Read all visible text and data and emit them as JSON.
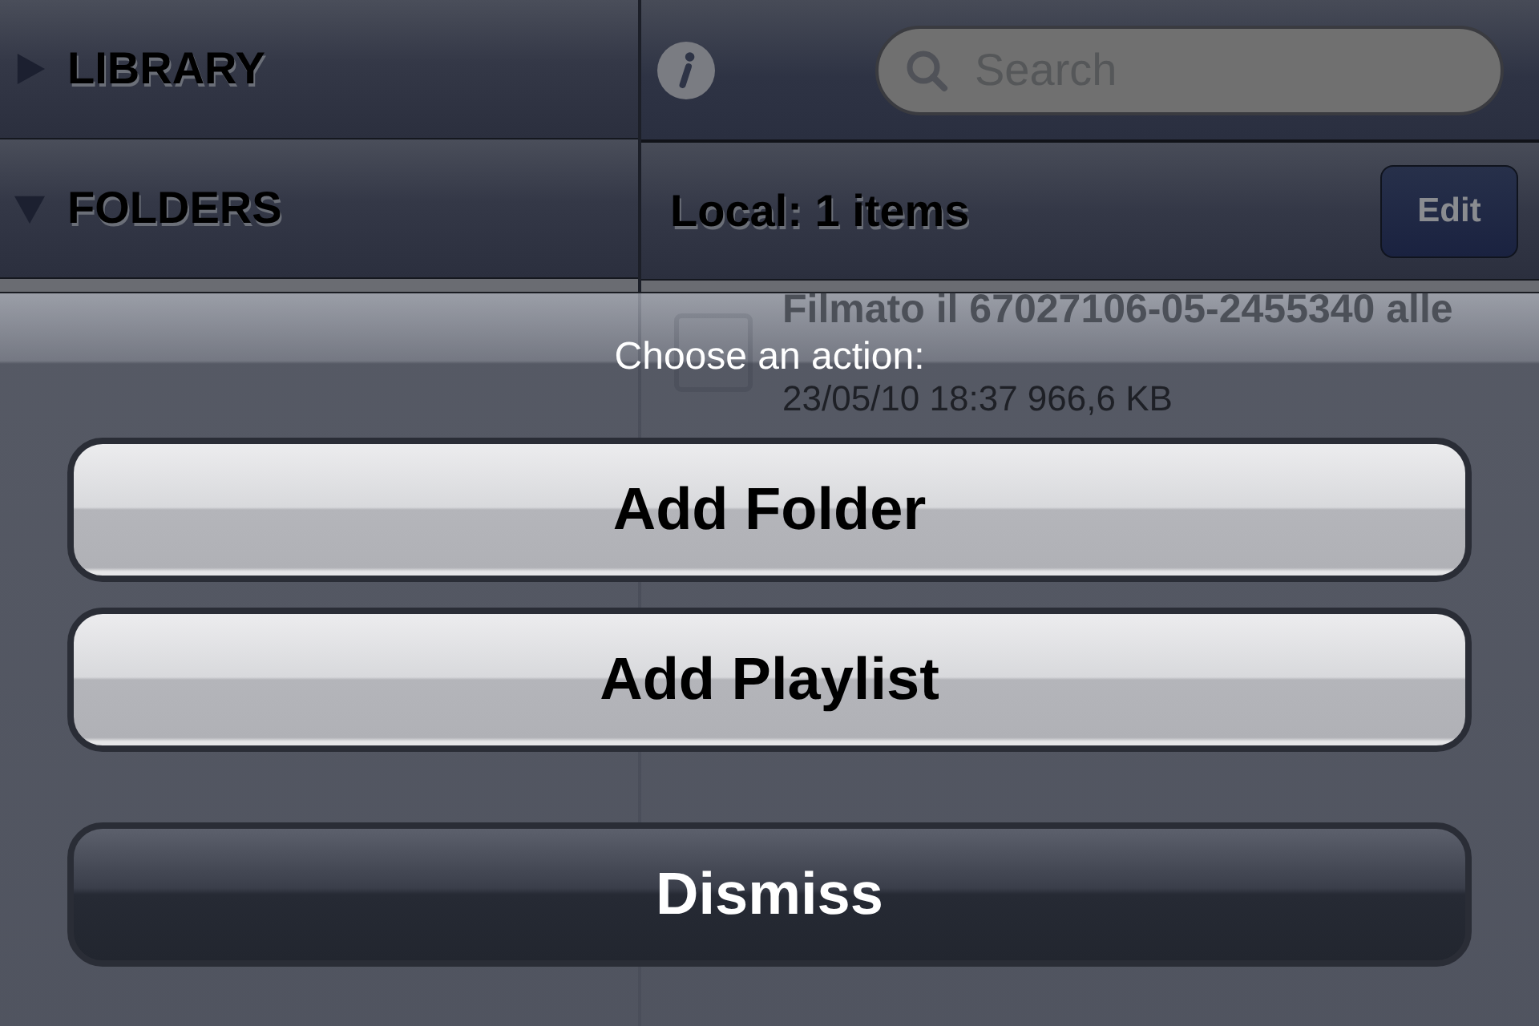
{
  "sidebar": {
    "sections": [
      {
        "label": "LIBRARY",
        "expanded": false
      },
      {
        "label": "FOLDERS",
        "expanded": true
      }
    ]
  },
  "toolbar": {
    "search": {
      "placeholder": "Search"
    }
  },
  "list_header": {
    "title": "Local: 1 items",
    "edit_button": "Edit"
  },
  "items": [
    {
      "title": "Filmato il 67027106-05-2455340 alle",
      "details": "23/05/10 18:37 966,6 KB"
    }
  ],
  "action_sheet": {
    "title": "Choose an action:",
    "buttons": [
      {
        "label": "Add Folder",
        "kind": "default"
      },
      {
        "label": "Add Playlist",
        "kind": "default"
      },
      {
        "label": "Dismiss",
        "kind": "cancel"
      }
    ]
  }
}
